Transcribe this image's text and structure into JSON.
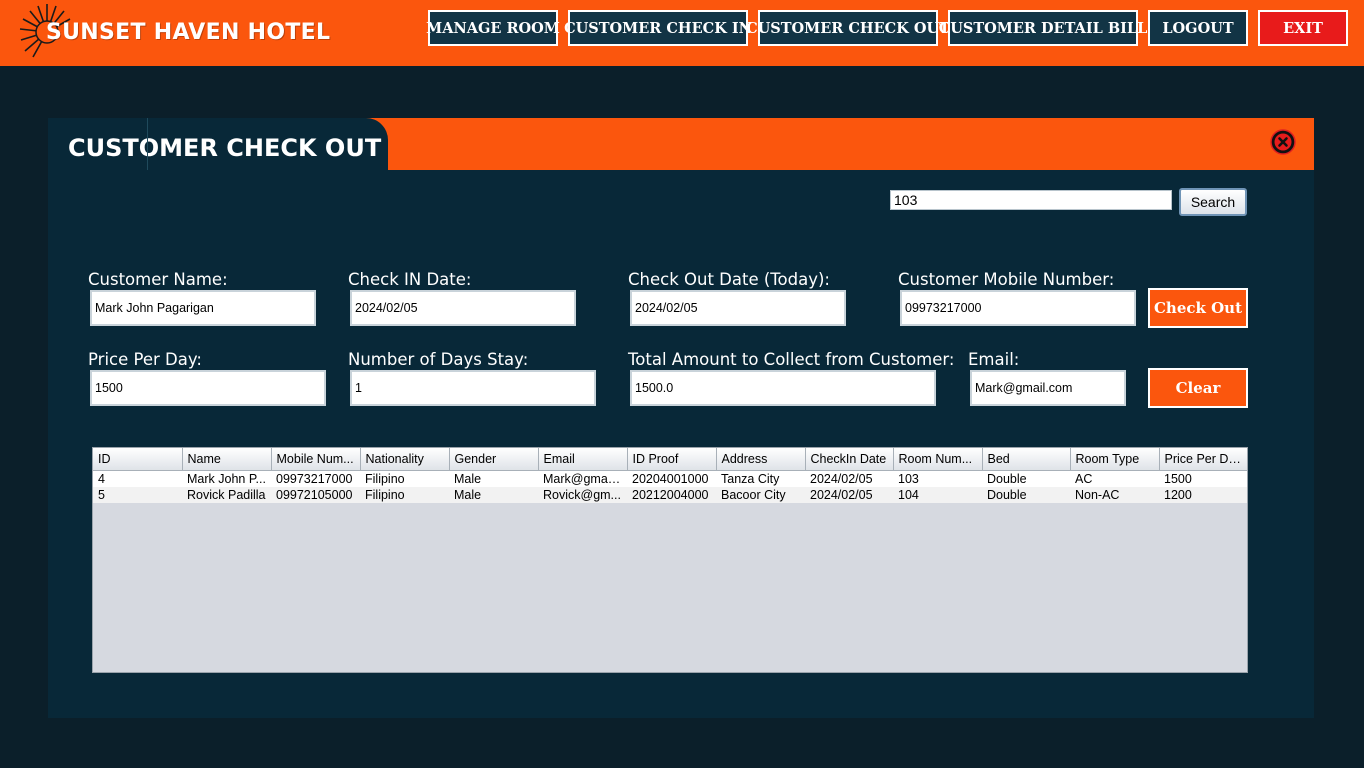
{
  "header": {
    "brand": "SUNSET HAVEN HOTEL",
    "nav": {
      "manage_room": "MANAGE ROOM",
      "check_in": "CUSTOMER CHECK IN",
      "check_out": "CUSTOMER CHECK OUT",
      "detail_bill": "CUSTOMER DETAIL BILL",
      "logout": "LOGOUT",
      "exit": "EXIT"
    }
  },
  "panel": {
    "title": "CUSTOMER CHECK OUT",
    "search": {
      "value": "103",
      "button": "Search"
    },
    "form": {
      "customer_name": {
        "label": "Customer Name:",
        "value": "Mark John Pagarigan"
      },
      "check_in_date": {
        "label": "Check IN Date:",
        "value": "2024/02/05"
      },
      "check_out_date": {
        "label": "Check Out Date (Today):",
        "value": "2024/02/05"
      },
      "mobile": {
        "label": "Customer Mobile Number:",
        "value": "09973217000"
      },
      "price_per_day": {
        "label": "Price Per Day:",
        "value": "1500"
      },
      "days_stay": {
        "label": "Number of Days Stay:",
        "value": "1"
      },
      "total_amount": {
        "label": "Total Amount to Collect from Customer:",
        "value": "1500.0"
      },
      "email": {
        "label": "Email:",
        "value": "Mark@gmail.com"
      }
    },
    "buttons": {
      "check_out": "Check Out",
      "clear": "Clear"
    },
    "table": {
      "columns": [
        "ID",
        "Name",
        "Mobile Num...",
        "Nationality",
        "Gender",
        "Email",
        "ID Proof",
        "Address",
        "CheckIn Date",
        "Room Num...",
        "Bed",
        "Room Type",
        "Price Per Day"
      ],
      "rows": [
        [
          "4",
          "Mark John P...",
          "09973217000",
          "Filipino",
          "Male",
          "Mark@gmail...",
          "20204001000",
          "Tanza City",
          "2024/02/05",
          "103",
          "Double",
          "AC",
          "1500"
        ],
        [
          "5",
          "Rovick Padilla",
          "09972105000",
          "Filipino",
          "Male",
          "Rovick@gm...",
          "20212004000",
          "Bacoor City",
          "2024/02/05",
          "104",
          "Double",
          "Non-AC",
          "1200"
        ]
      ]
    }
  },
  "colors": {
    "accent_orange": "#fb560d",
    "panel_bg": "#082838",
    "page_bg": "#0b1f2a",
    "nav_button_bg": "#123445",
    "exit_red": "#e81b1b"
  },
  "icons": {
    "logo": "sunburst-icon",
    "close": "close-circle-icon"
  }
}
